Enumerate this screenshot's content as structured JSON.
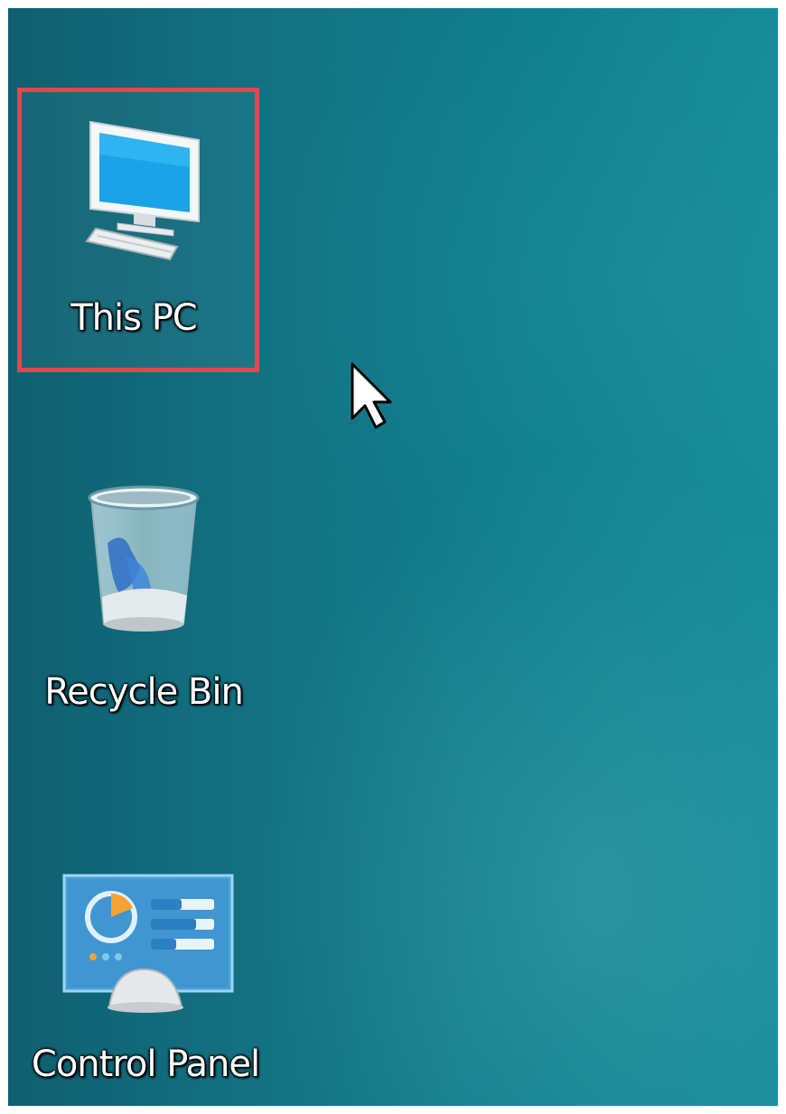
{
  "desktop": {
    "icons": [
      {
        "label": "This PC",
        "icon": "this-pc-icon",
        "selected": true
      },
      {
        "label": "Recycle Bin",
        "icon": "recycle-bin-icon",
        "selected": false
      },
      {
        "label": "Control Panel",
        "icon": "control-panel-icon",
        "selected": false
      }
    ],
    "highlight_color": "#e0474f",
    "background_color": "#137383"
  },
  "cursor": {
    "icon": "mouse-pointer-icon"
  }
}
